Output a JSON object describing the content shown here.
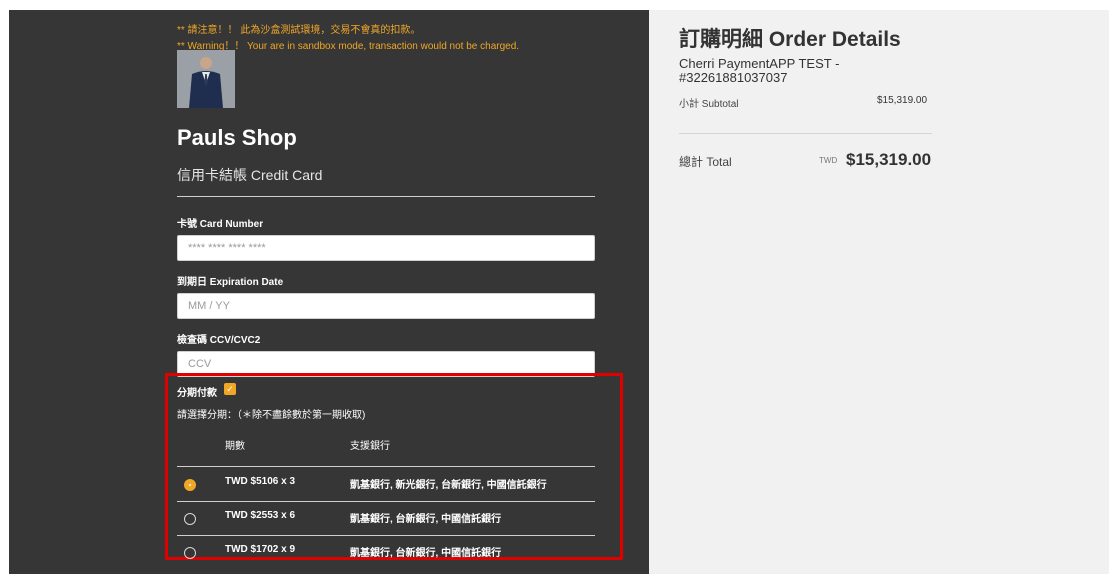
{
  "warning": {
    "zh": "** 請注意！！ 此為沙盒測試環境，交易不會真的扣款。",
    "en": "** Warning！！ Your are in sandbox mode, transaction would not be charged."
  },
  "shop": {
    "name": "Pauls Shop",
    "method": "信用卡結帳 Credit Card"
  },
  "form": {
    "card_label": "卡號 Card Number",
    "card_placeholder": "**** **** **** ****",
    "exp_label": "到期日 Expiration Date",
    "exp_placeholder": "MM / YY",
    "ccv_label": "檢查碼 CCV/CVC2",
    "ccv_placeholder": "CCV"
  },
  "installment": {
    "title": "分期付款",
    "checked": true,
    "note": "請選擇分期：（＊除不盡餘數於第一期收取)",
    "col_period": "期數",
    "col_banks": "支援銀行",
    "plans": [
      {
        "amount": "TWD $5106 x 3",
        "banks": "凱基銀行, 新光銀行, 台新銀行, 中國信託銀行",
        "selected": true
      },
      {
        "amount": "TWD $2553 x 6",
        "banks": "凱基銀行, 台新銀行, 中國信託銀行",
        "selected": false
      },
      {
        "amount": "TWD $1702 x 9",
        "banks": "凱基銀行, 台新銀行, 中國信託銀行",
        "selected": false
      }
    ]
  },
  "order": {
    "title": "訂購明細 Order Details",
    "item_name": "Cherri PaymentAPP TEST - #32261881037037",
    "subtotal_label": "小計 Subtotal",
    "subtotal_value": "$15,319.00",
    "total_label": "總計 Total",
    "currency": "TWD",
    "total_value": "$15,319.00"
  },
  "colors": {
    "panel": "#363636",
    "accent": "#f0a726",
    "highlight": "#e00000"
  }
}
